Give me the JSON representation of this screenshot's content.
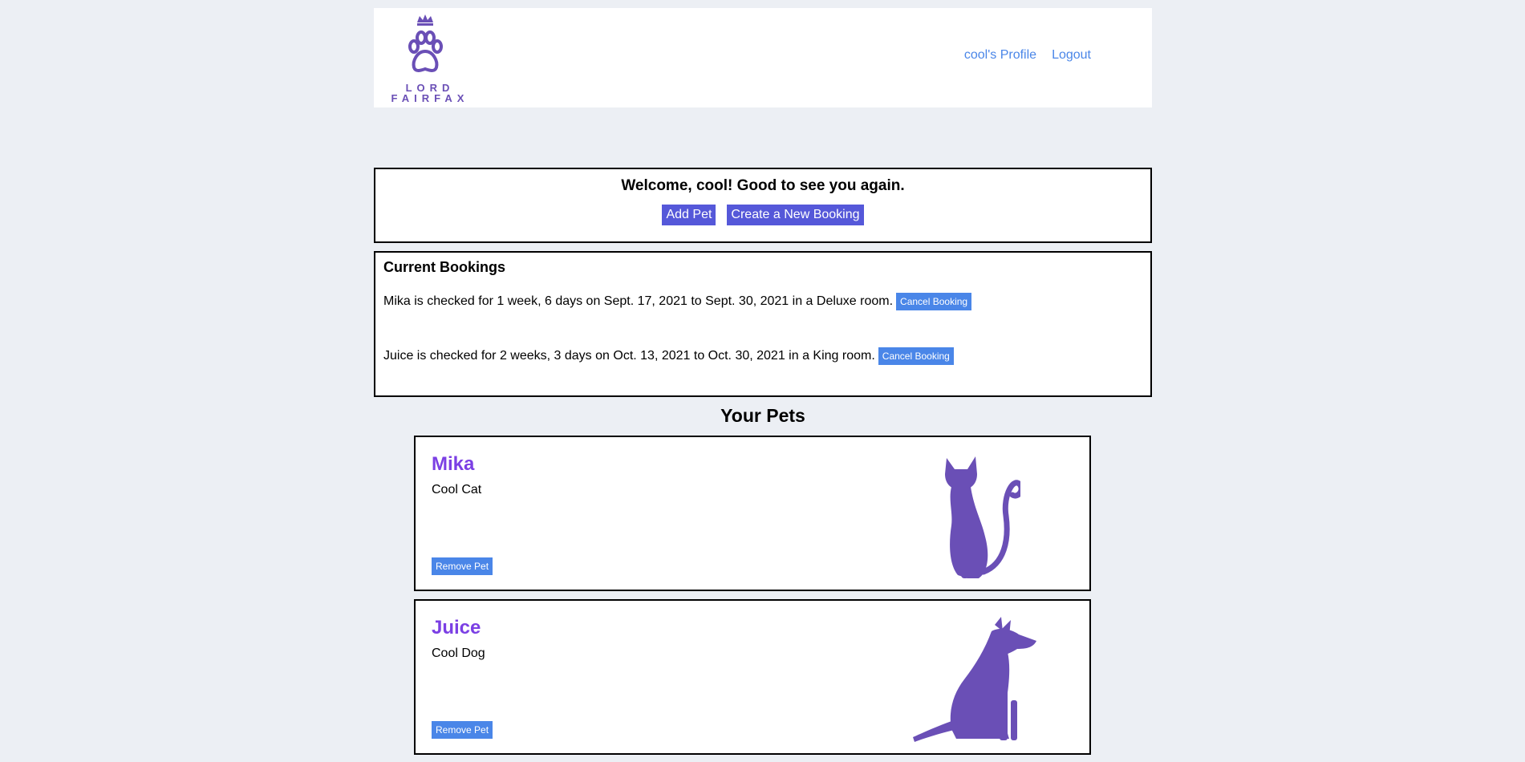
{
  "brand": {
    "line1": "LORD",
    "line2": "FAIRFAX",
    "color": "#6a4fb6"
  },
  "nav": {
    "profile": "cool's Profile",
    "logout": "Logout"
  },
  "welcome": {
    "message": "Welcome, cool! Good to see you again.",
    "add_pet": "Add Pet",
    "new_booking": "Create a New Booking"
  },
  "bookings": {
    "title": "Current Bookings",
    "items": [
      {
        "text": "Mika is checked for 1 week, 6 days on Sept. 17, 2021 to Sept. 30, 2021 in a Deluxe room.",
        "cancel": "Cancel Booking"
      },
      {
        "text": "Juice is checked for 2 weeks, 3 days on Oct. 13, 2021 to Oct. 30, 2021 in a King room.",
        "cancel": "Cancel Booking"
      }
    ]
  },
  "pets": {
    "title": "Your Pets",
    "items": [
      {
        "name": "Mika",
        "desc": "Cool Cat",
        "remove": "Remove Pet",
        "icon": "cat-silhouette-icon"
      },
      {
        "name": "Juice",
        "desc": "Cool Dog",
        "remove": "Remove Pet",
        "icon": "dog-silhouette-icon"
      }
    ]
  },
  "colors": {
    "accent": "#5558d9",
    "link": "#4a86e8",
    "pet_name": "#7b3fe4",
    "silhouette": "#6a4fb6"
  }
}
